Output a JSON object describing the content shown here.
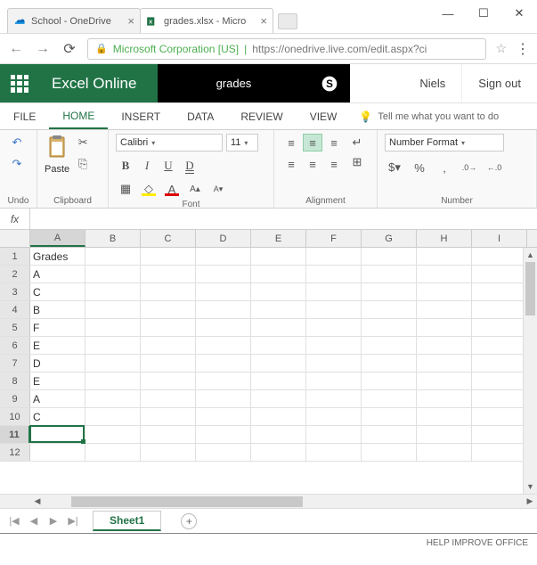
{
  "browser": {
    "tabs": [
      {
        "title": "School - OneDrive",
        "active": false
      },
      {
        "title": "grades.xlsx - Micro",
        "active": true
      }
    ],
    "corp": "Microsoft Corporation [US]",
    "url": "https://onedrive.live.com/edit.aspx?ci"
  },
  "header": {
    "brand": "Excel Online",
    "docname": "grades",
    "user": "Niels",
    "signout": "Sign out"
  },
  "ribbon_tabs": [
    "FILE",
    "HOME",
    "INSERT",
    "DATA",
    "REVIEW",
    "VIEW"
  ],
  "ribbon_active": "HOME",
  "tellme": "Tell me what you want to do",
  "ribbon": {
    "undo_label": "Undo",
    "clipboard_label": "Clipboard",
    "paste_label": "Paste",
    "font_label": "Font",
    "font_name": "Calibri",
    "font_size": "11",
    "alignment_label": "Alignment",
    "number_label": "Number",
    "number_format": "Number Format"
  },
  "fx_label": "fx",
  "formula_value": "",
  "columns": [
    "A",
    "B",
    "C",
    "D",
    "E",
    "F",
    "G",
    "H",
    "I"
  ],
  "selected_col": "A",
  "selected_row": 11,
  "row_count": 12,
  "cells": {
    "A1": "Grades",
    "A2": "A",
    "A3": "C",
    "A4": "B",
    "A5": "F",
    "A6": "E",
    "A7": "D",
    "A8": "E",
    "A9": "A",
    "A10": "C"
  },
  "sheet": {
    "name": "Sheet1"
  },
  "status": "HELP IMPROVE OFFICE",
  "chart_data": {
    "type": "table",
    "title": "Grades",
    "columns": [
      "Grades"
    ],
    "rows": [
      [
        "A"
      ],
      [
        "C"
      ],
      [
        "B"
      ],
      [
        "F"
      ],
      [
        "E"
      ],
      [
        "D"
      ],
      [
        "E"
      ],
      [
        "A"
      ],
      [
        "C"
      ]
    ]
  }
}
